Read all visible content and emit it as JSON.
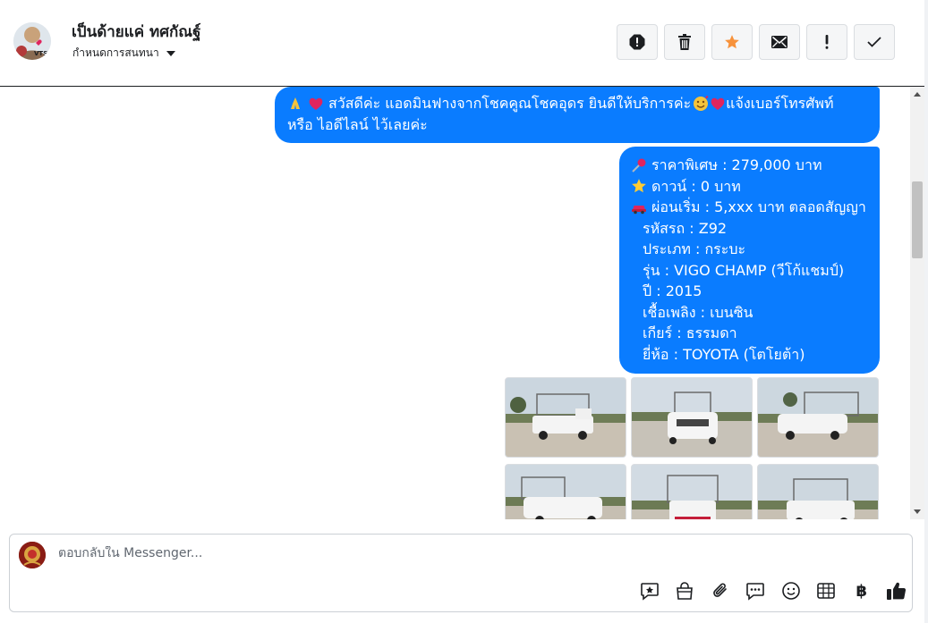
{
  "header": {
    "contact_name": "เป็นด้ายแค่ ทศกัณฐ์",
    "assign_label": "กำหนดการสนทนา",
    "avatar_badge": "VTS",
    "actions": [
      {
        "name": "spam-button",
        "icon": "alert-circle-icon"
      },
      {
        "name": "delete-button",
        "icon": "trash-icon"
      },
      {
        "name": "star-button",
        "icon": "star-icon",
        "color": "#f7923b"
      },
      {
        "name": "mark-unread-button",
        "icon": "envelope-icon"
      },
      {
        "name": "follow-up-button",
        "icon": "exclamation-icon"
      },
      {
        "name": "mark-done-button",
        "icon": "check-icon"
      }
    ]
  },
  "messages": {
    "greeting": {
      "line1": "สวัสดีค่ะ แอดมินฟางจากโชคคูณโชคอุดร ยินดีให้บริการค่ะ",
      "line1_tail": "แจ้งเบอร์โทรศัพท์",
      "line2": "หรือ ไอดีไลน์  ไว้เลยค่ะ"
    },
    "details": {
      "price": "ราคาพิเศษ : 279,000 บาท",
      "down": "ดาวน์ : 0 บาท",
      "installment": "ผ่อนเริ่ม : 5,xxx บาท ตลอดสัญญา",
      "code": "รหัสรถ : Z92",
      "type": "ประเภท : กระบะ",
      "model": "รุ่น : VIGO CHAMP (วีโก้แชมป์)",
      "year": "ปี : 2015",
      "fuel": "เชื้อเพลิง : เบนซิน",
      "gear": "เกียร์ : ธรรมดา",
      "brand": "ยี่ห้อ : TOYOTA (โตโยต้า)"
    },
    "bubble_color": "#0a7cff",
    "photo_count": 6
  },
  "composer": {
    "placeholder": "ตอบกลับใน Messenger...",
    "tools": [
      "saved-reply-icon",
      "shop-bag-icon",
      "paperclip-icon",
      "chat-bubble-icon",
      "emoji-icon",
      "table-icon",
      "baht-icon",
      "thumbs-up-icon"
    ],
    "baht_symbol": "฿"
  }
}
